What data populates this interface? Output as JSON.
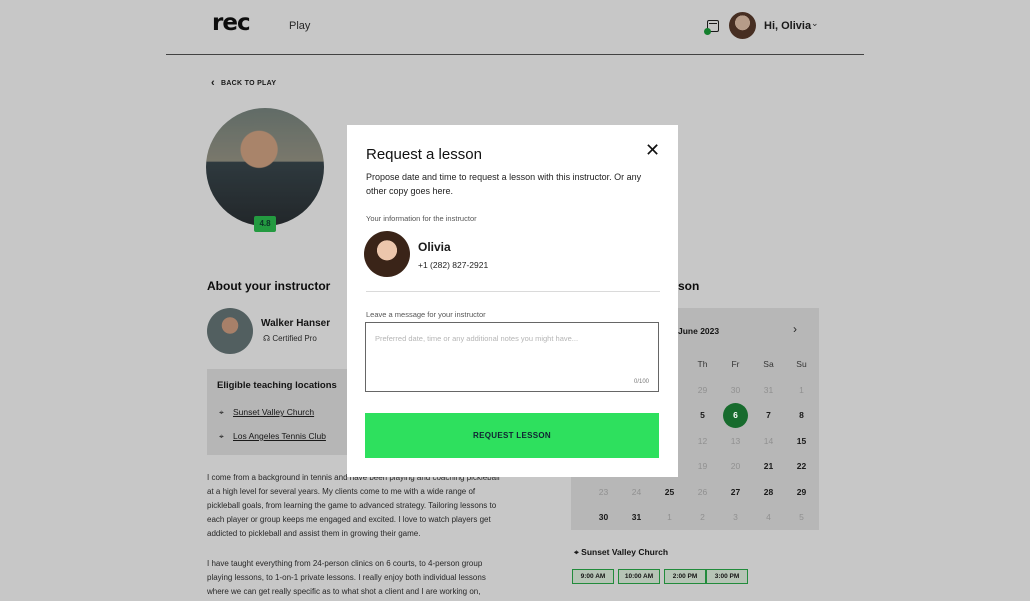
{
  "header": {
    "logo": "rec",
    "nav_play": "Play",
    "greeting": "Hi, Olivia",
    "chevron": "⌄"
  },
  "page": {
    "back_label": "BACK TO PLAY",
    "rating": "4.8",
    "about_title": "About your instructor",
    "instructor_name": "Walker Hanser",
    "instructor_cert": "Certified Pro",
    "locations_title": "Eligible teaching locations",
    "locations": [
      "Sunset Valley Church",
      "Los Angeles Tennis Club"
    ],
    "bio_1": "I come from a background in tennis and have been playing and coaching pickleball at a high level for several years. My clients come to me with a wide range of pickleball goals, from learning the game to advanced strategy. Tailoring lessons to each player or group keeps me engaged and excited. I love to watch players get addicted to pickleball and assist them in growing their game.",
    "bio_2": "I have taught everything from 24-person clinics on 6 courts, to 4-person group playing lessons, to 1-on-1 private lessons. I really enjoy both individual lessons where we can get really specific as to what shot a client and I are working on,",
    "lesson_title_partial": "son",
    "calendar": {
      "month": "June 2023",
      "weekdays": [
        "Th",
        "Fr",
        "Sa",
        "Su"
      ],
      "rows": [
        [
          {
            "d": "29",
            "s": "muted"
          },
          {
            "d": "30",
            "s": "muted"
          },
          {
            "d": "31",
            "s": "muted"
          },
          {
            "d": "1",
            "s": "muted"
          }
        ],
        [
          {
            "d": "5",
            "s": "active"
          },
          {
            "d": "6",
            "s": "sel"
          },
          {
            "d": "7",
            "s": "active"
          },
          {
            "d": "8",
            "s": "active"
          }
        ],
        [
          {
            "d": "12",
            "s": "muted"
          },
          {
            "d": "13",
            "s": "muted"
          },
          {
            "d": "14",
            "s": "muted"
          },
          {
            "d": "15",
            "s": "active"
          }
        ],
        [
          {
            "d": "19",
            "s": "muted"
          },
          {
            "d": "20",
            "s": "muted"
          },
          {
            "d": "21",
            "s": "active"
          },
          {
            "d": "22",
            "s": "active"
          }
        ],
        [
          {
            "d": "23",
            "s": "muted"
          },
          {
            "d": "24",
            "s": "muted"
          },
          {
            "d": "25",
            "s": "active"
          },
          {
            "d": "26",
            "s": "muted"
          },
          {
            "d": "27",
            "s": "active"
          },
          {
            "d": "28",
            "s": "active"
          },
          {
            "d": "29",
            "s": "active"
          }
        ],
        [
          {
            "d": "30",
            "s": "active"
          },
          {
            "d": "31",
            "s": "active"
          },
          {
            "d": "1",
            "s": "muted"
          },
          {
            "d": "2",
            "s": "muted"
          },
          {
            "d": "3",
            "s": "muted"
          },
          {
            "d": "4",
            "s": "muted"
          },
          {
            "d": "5",
            "s": "muted"
          }
        ]
      ]
    },
    "venue": "Sunset Valley Church",
    "time_slots": [
      "9:00 AM",
      "10:00 AM",
      "2:00 PM",
      "3:00 PM"
    ]
  },
  "modal": {
    "title": "Request a lesson",
    "close": "✕",
    "description": "Propose date and time to request a lesson with this instructor. Or any other copy goes here.",
    "info_label": "Your information for the instructor",
    "user_name": "Olivia",
    "user_phone": "+1 (282) 827-2921",
    "message_label": "Leave a message for your instructor",
    "message_placeholder": "Preferred date, time or any additional notes you might have...",
    "char_count": "0/100",
    "submit_label": "REQUEST LESSON"
  },
  "colors": {
    "accent_green": "#2ee05e",
    "selected_day": "#1e8a3a",
    "overlay": "rgba(0,0,0,0.22)"
  }
}
